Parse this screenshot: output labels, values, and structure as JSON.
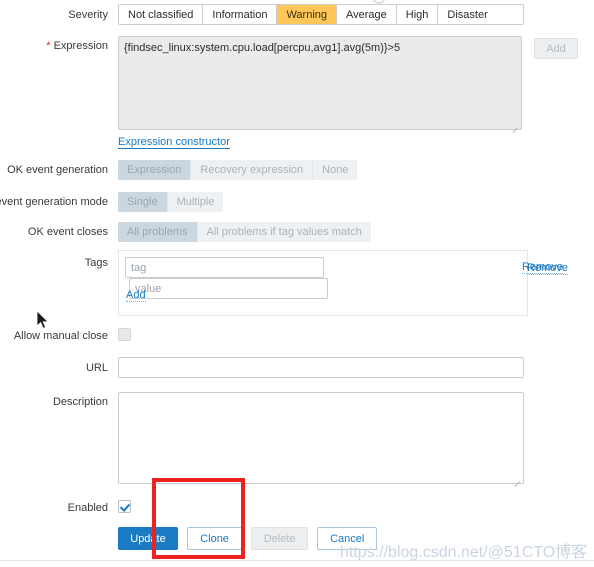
{
  "form": {
    "severity": {
      "label": "Severity",
      "options": [
        "Not classified",
        "Information",
        "Warning",
        "Average",
        "High",
        "Disaster"
      ],
      "selected": "Warning",
      "selected_color": "#ffc659"
    },
    "expression": {
      "label": "Expression",
      "required_marker": "*",
      "value": "{findsec_linux:system.cpu.load[percpu,avg1].avg(5m)}>5",
      "add_button": "Add",
      "constructor_link": "Expression constructor"
    },
    "ok_event_generation": {
      "label": "OK event generation",
      "options": [
        "Expression",
        "Recovery expression",
        "None"
      ],
      "selected": "Expression"
    },
    "problem_event_generation_mode": {
      "label": "event generation mode",
      "options": [
        "Single",
        "Multiple"
      ],
      "selected": "Single"
    },
    "ok_event_closes": {
      "label": "OK event closes",
      "options": [
        "All problems",
        "All problems if tag values match"
      ],
      "selected": "All problems"
    },
    "tags": {
      "label": "Tags",
      "rows": [
        {
          "tag_value": "",
          "tag_placeholder": "tag",
          "value_value": "",
          "value_placeholder": "value",
          "remove_label": "Remove"
        }
      ],
      "add_label": "Add"
    },
    "allow_manual_close": {
      "label": "Allow manual close",
      "checked": false,
      "disabled": true
    },
    "url": {
      "label": "URL",
      "value": "",
      "placeholder": ""
    },
    "description": {
      "label": "Description",
      "value": "",
      "placeholder": ""
    },
    "enabled": {
      "label": "Enabled",
      "checked": true
    },
    "footer_buttons": [
      {
        "label": "Update",
        "style": "primary",
        "disabled": false
      },
      {
        "label": "Clone",
        "style": "secondary",
        "disabled": false
      },
      {
        "label": "Delete",
        "style": "disabled",
        "disabled": true
      },
      {
        "label": "Cancel",
        "style": "secondary",
        "disabled": false
      }
    ]
  },
  "annotation": {
    "color": "#ef2222"
  },
  "watermark": {
    "text": "https://blog.csdn.net/@51CTO博客",
    "color": "#c9d4e0"
  }
}
